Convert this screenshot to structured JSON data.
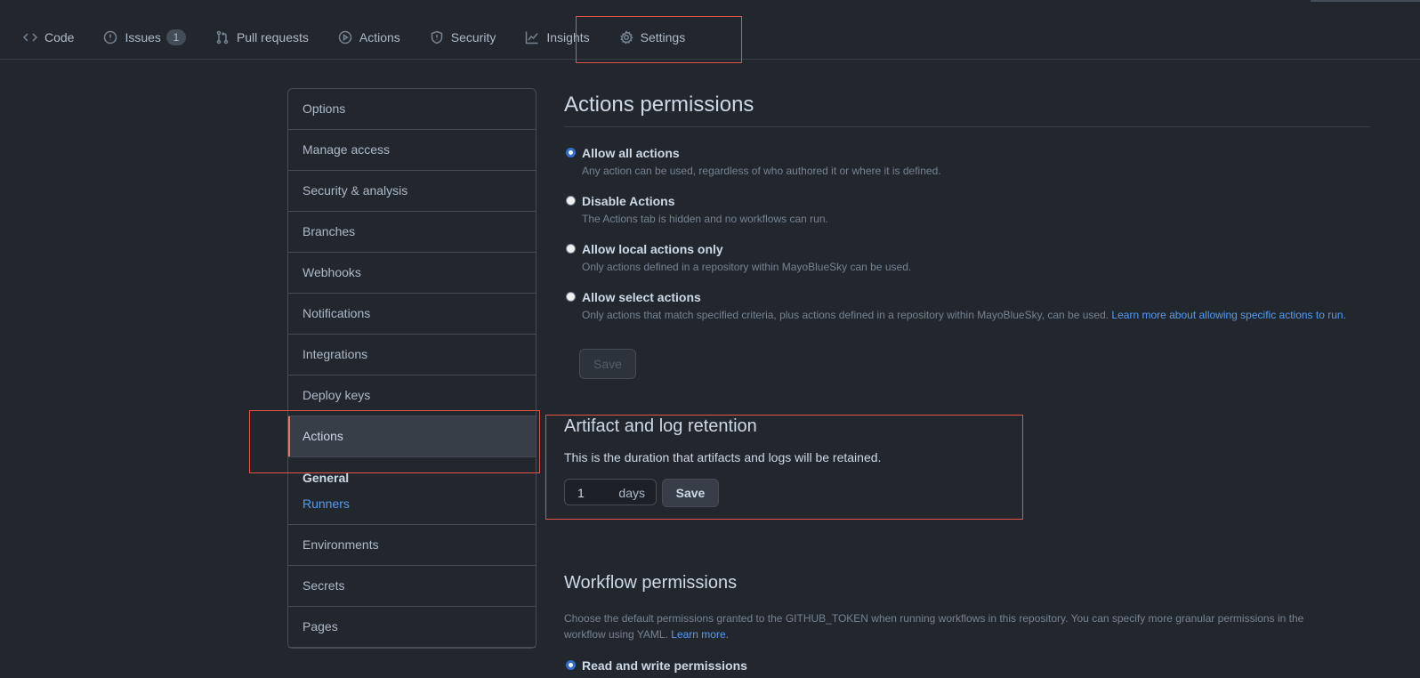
{
  "tabs": [
    {
      "label": "Code",
      "icon": "code-icon"
    },
    {
      "label": "Issues",
      "icon": "issue-icon",
      "count": "1"
    },
    {
      "label": "Pull requests",
      "icon": "pull-request-icon"
    },
    {
      "label": "Actions",
      "icon": "play-icon"
    },
    {
      "label": "Security",
      "icon": "shield-icon"
    },
    {
      "label": "Insights",
      "icon": "graph-icon"
    },
    {
      "label": "Settings",
      "icon": "gear-icon"
    }
  ],
  "sidebar": {
    "items": [
      "Options",
      "Manage access",
      "Security & analysis",
      "Branches",
      "Webhooks",
      "Notifications",
      "Integrations",
      "Deploy keys",
      "Actions"
    ],
    "submenu": {
      "heading": "General",
      "link": "Runners"
    },
    "items_after": [
      "Environments",
      "Secrets",
      "Pages"
    ]
  },
  "actions_permissions": {
    "title": "Actions permissions",
    "options": [
      {
        "label": "Allow all actions",
        "note": "Any action can be used, regardless of who authored it or where it is defined.",
        "checked": true
      },
      {
        "label": "Disable Actions",
        "note": "The Actions tab is hidden and no workflows can run.",
        "checked": false
      },
      {
        "label": "Allow local actions only",
        "note": "Only actions defined in a repository within MayoBlueSky can be used.",
        "checked": false
      },
      {
        "label": "Allow select actions",
        "note": "Only actions that match specified criteria, plus actions defined in a repository within MayoBlueSky, can be used.",
        "link": "Learn more about allowing specific actions to run.",
        "checked": false
      }
    ],
    "save_label": "Save"
  },
  "retention": {
    "title": "Artifact and log retention",
    "description": "This is the duration that artifacts and logs will be retained.",
    "days_value": "1",
    "days_unit": "days",
    "save_label": "Save"
  },
  "workflow_permissions": {
    "title": "Workflow permissions",
    "description": "Choose the default permissions granted to the GITHUB_TOKEN when running workflows in this repository. You can specify more granular permissions in the workflow using YAML.",
    "learn_more": "Learn more.",
    "option_label": "Read and write permissions"
  },
  "colors": {
    "highlight": "#e5534b",
    "accent_link": "#539bf5",
    "selected_bar": "#ec775c"
  }
}
